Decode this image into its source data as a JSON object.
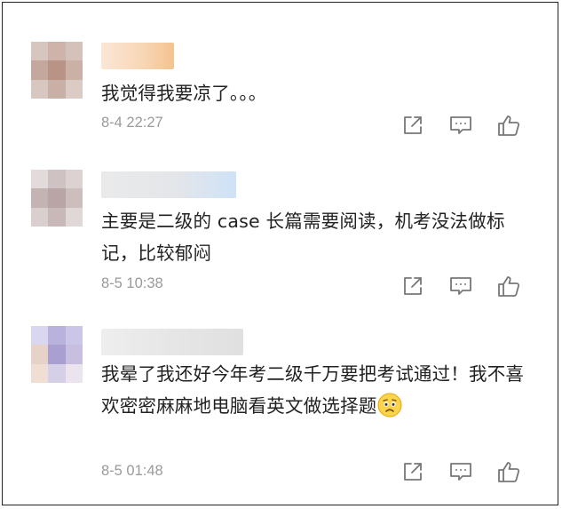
{
  "comments": [
    {
      "text": "我觉得我要凉了。。。",
      "time": "8-4 22:27",
      "name_colors": [
        "#fbe3cf",
        "#f9d3b0",
        "#f6c48f"
      ]
    },
    {
      "text": "主要是二级的 case 长篇需要阅读，机考没法做标记，比较郁闷",
      "time": "8-5 10:38",
      "name_colors": [
        "#e9e9ea",
        "#e2e6ec",
        "#d7e6f6"
      ]
    },
    {
      "text": "我晕了我还好今年考二级千万要把考试通过！我不喜欢密密麻麻地电脑看英文做选择题",
      "emoji": "worried-face-emoji",
      "time": "8-5 01:48",
      "name_colors": [
        "#ececec",
        "#e7e7e7",
        "#e2e2e2"
      ]
    }
  ],
  "icons": {
    "share": "share-icon",
    "reply": "reply-comment-icon",
    "like": "thumbs-up-icon"
  },
  "colors": {
    "text": "#222222",
    "timestamp": "#9a9a9a",
    "icon": "#777777"
  }
}
